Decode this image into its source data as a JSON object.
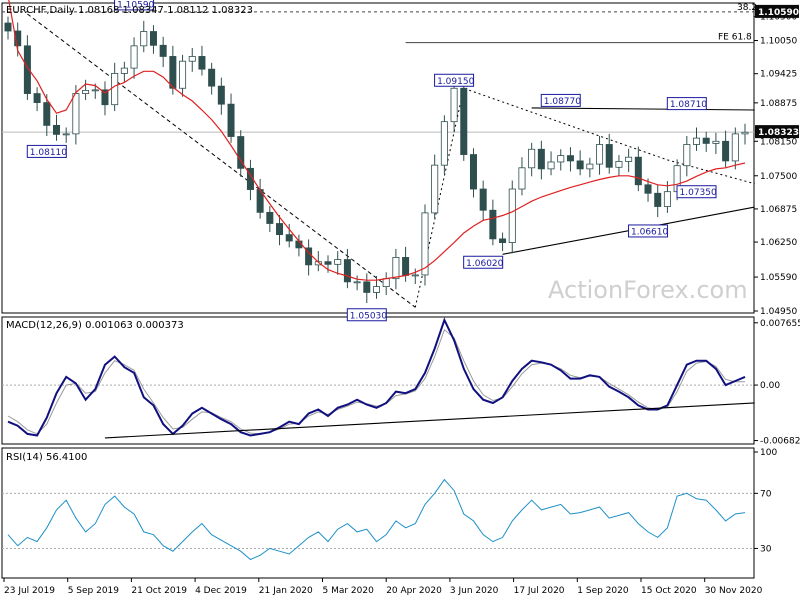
{
  "window": {
    "symbol": "EURCHF,Daily",
    "ohlc": "1.08168 1.08347 1.08112 1.08323",
    "watermark": "ActionForex.com"
  },
  "chart_data": [
    {
      "type": "candlestick",
      "panel": "price",
      "ylim": [
        1.0495,
        1.1072
      ],
      "y_ticks": [
        "1.10500",
        "1.10050",
        "1.09425",
        "1.08875",
        "1.08323",
        "1.08150",
        "1.07500",
        "1.06875",
        "1.06250",
        "1.05590",
        "1.04950"
      ],
      "current_price": "1.08323",
      "top_price_label": "1.10590",
      "top_level_label": "38.2",
      "fe_label": "FE 61.8",
      "fe_level": 1.1001,
      "resistance_line": [
        {
          "x": 54,
          "y": 1.0878
        },
        {
          "x": 77,
          "y": 1.0874
        }
      ],
      "support_line": [
        {
          "x": 51,
          "y": 1.0602
        },
        {
          "x": 77,
          "y": 1.0691
        }
      ],
      "down_trend_line": [
        {
          "x": 2,
          "y": 1.1055
        },
        {
          "x": 42,
          "y": 1.0502
        }
      ],
      "projection_line": [
        {
          "x": 42,
          "y": 1.0502
        },
        {
          "x": 47,
          "y": 1.0915
        },
        {
          "x": 68,
          "y": 1.078
        },
        {
          "x": 77,
          "y": 1.0735
        }
      ],
      "fe_line_x": [
        41,
        77
      ],
      "annotations": [
        {
          "text": "1.10590",
          "x": 13,
          "y": 1.1059
        },
        {
          "text": "1.08110",
          "x": 4,
          "y": 1.0811
        },
        {
          "text": "1.09150",
          "x": 46,
          "y": 1.0915
        },
        {
          "text": "1.08770",
          "x": 57,
          "y": 1.0877
        },
        {
          "text": "1.08710",
          "x": 70,
          "y": 1.0871
        },
        {
          "text": "1.07350",
          "x": 71,
          "y": 1.0735
        },
        {
          "text": "1.06610",
          "x": 66,
          "y": 1.0661
        },
        {
          "text": "1.06020",
          "x": 49,
          "y": 1.0602
        },
        {
          "text": "1.05030",
          "x": 37,
          "y": 1.0503
        }
      ],
      "closes": [
        1.1023,
        1.0995,
        1.0905,
        1.0888,
        1.0845,
        1.0828,
        1.0829,
        1.0905,
        1.0911,
        1.0912,
        1.0884,
        1.0943,
        1.0953,
        1.0995,
        1.1022,
        1.0996,
        1.0975,
        1.0915,
        1.0966,
        1.0975,
        1.0951,
        1.0919,
        1.0885,
        1.0824,
        1.0764,
        1.0724,
        1.0681,
        1.066,
        1.0639,
        1.0627,
        1.0614,
        1.0582,
        1.0588,
        1.0583,
        1.0592,
        1.055,
        1.055,
        1.053,
        1.0541,
        1.0556,
        1.0596,
        1.0562,
        1.0563,
        1.068,
        1.077,
        1.0852,
        1.0915,
        1.079,
        1.0725,
        1.0685,
        1.0631,
        1.0624,
        1.0725,
        1.0765,
        1.08,
        1.0763,
        1.0776,
        1.0788,
        1.0778,
        1.0763,
        1.0772,
        1.0809,
        1.0766,
        1.0777,
        1.0785,
        1.0733,
        1.0717,
        1.0692,
        1.072,
        1.0769,
        1.0809,
        1.0821,
        1.0811,
        1.0815,
        1.0778,
        1.0829,
        1.0832
      ],
      "moving_average": [
        1.109,
        1.0986,
        1.0954,
        1.0929,
        1.0894,
        1.0868,
        1.0874,
        1.0907,
        1.0923,
        1.092,
        1.0906,
        1.0919,
        1.0926,
        1.0938,
        1.0947,
        1.0947,
        1.0936,
        1.0917,
        1.0903,
        1.0891,
        1.0874,
        1.0856,
        1.0834,
        1.0807,
        1.0779,
        1.0751,
        1.0723,
        1.0697,
        1.0672,
        1.0649,
        1.0627,
        1.0605,
        1.0587,
        1.0573,
        1.0566,
        1.0561,
        1.0555,
        1.0553,
        1.0553,
        1.0556,
        1.0559,
        1.0562,
        1.0568,
        1.0576,
        1.059,
        1.0607,
        1.0624,
        1.0642,
        1.0655,
        1.0666,
        1.067,
        1.0675,
        1.0682,
        1.0692,
        1.0702,
        1.071,
        1.0716,
        1.0722,
        1.0728,
        1.0733,
        1.0738,
        1.0743,
        1.0747,
        1.075,
        1.075,
        1.0746,
        1.0739,
        1.0733,
        1.0731,
        1.0734,
        1.074,
        1.0749,
        1.0757,
        1.0763,
        1.0765,
        1.077,
        1.0774
      ]
    },
    {
      "type": "line",
      "panel": "macd",
      "label": "MACD(12,26,9) 0.001063 0.000373",
      "ylim": [
        -0.007,
        0.008
      ],
      "y_ticks": [
        "0.007655",
        "0.00",
        "-0.006822"
      ],
      "trend_line": [
        {
          "x": 10,
          "y": -0.0065
        },
        {
          "x": 77,
          "y": -0.0022
        }
      ],
      "macd": [
        -0.0045,
        -0.005,
        -0.006,
        -0.0062,
        -0.004,
        -0.001,
        0.001,
        0.0002,
        -0.0018,
        -0.0005,
        0.0025,
        0.0035,
        0.0022,
        0.0015,
        -0.0015,
        -0.0025,
        -0.0048,
        -0.006,
        -0.005,
        -0.0035,
        -0.0028,
        -0.0035,
        -0.0042,
        -0.0048,
        -0.0058,
        -0.0062,
        -0.006,
        -0.0058,
        -0.0052,
        -0.0045,
        -0.0048,
        -0.0035,
        -0.003,
        -0.0038,
        -0.0028,
        -0.0024,
        -0.0018,
        -0.0024,
        -0.0028,
        -0.0022,
        -0.0008,
        -0.001,
        -0.0005,
        0.0015,
        0.0045,
        0.008,
        0.0055,
        0.002,
        -0.0005,
        -0.0018,
        -0.0022,
        -0.0015,
        0.0005,
        0.002,
        0.003,
        0.0028,
        0.0025,
        0.0018,
        0.0008,
        0.0008,
        0.0012,
        0.001,
        -0.0002,
        -0.0008,
        -0.0015,
        -0.0025,
        -0.003,
        -0.003,
        -0.0025,
        0.0,
        0.0025,
        0.003,
        0.003,
        0.002,
        0.0,
        0.0005,
        0.001
      ],
      "signal": [
        -0.0038,
        -0.0045,
        -0.0055,
        -0.006,
        -0.0048,
        -0.0022,
        0.0,
        0.0002,
        -0.001,
        -0.0008,
        0.0015,
        0.003,
        0.0025,
        0.0018,
        -0.0005,
        -0.0022,
        -0.004,
        -0.0054,
        -0.0052,
        -0.0042,
        -0.0033,
        -0.0034,
        -0.004,
        -0.0045,
        -0.0054,
        -0.0059,
        -0.006,
        -0.0058,
        -0.0054,
        -0.0048,
        -0.0047,
        -0.0038,
        -0.0033,
        -0.0036,
        -0.003,
        -0.0026,
        -0.0021,
        -0.0023,
        -0.0026,
        -0.0023,
        -0.0013,
        -0.0011,
        -0.0007,
        0.0008,
        0.0035,
        0.0068,
        0.0058,
        0.003,
        0.0005,
        -0.0012,
        -0.0019,
        -0.0016,
        -0.0002,
        0.0014,
        0.0025,
        0.0027,
        0.0025,
        0.002,
        0.0012,
        0.0009,
        0.0011,
        0.001,
        0.0002,
        -0.0005,
        -0.0012,
        -0.0021,
        -0.0028,
        -0.003,
        -0.0027,
        -0.0008,
        0.0017,
        0.0027,
        0.0029,
        0.0023,
        0.0007,
        0.0004,
        0.0004
      ]
    },
    {
      "type": "line",
      "panel": "rsi",
      "label": "RSI(14) 56.4100",
      "ylim": [
        10,
        100
      ],
      "y_ticks": [
        "100",
        "70",
        "30"
      ],
      "rsi": [
        40,
        32,
        38,
        35,
        45,
        58,
        65,
        52,
        42,
        48,
        62,
        68,
        60,
        55,
        42,
        40,
        32,
        28,
        35,
        42,
        48,
        40,
        36,
        32,
        28,
        22,
        25,
        30,
        28,
        26,
        32,
        38,
        42,
        35,
        44,
        48,
        42,
        44,
        35,
        40,
        50,
        45,
        48,
        62,
        70,
        80,
        72,
        55,
        50,
        40,
        35,
        38,
        50,
        58,
        65,
        58,
        60,
        62,
        55,
        56,
        58,
        60,
        52,
        54,
        56,
        48,
        42,
        38,
        45,
        68,
        70,
        66,
        65,
        58,
        50,
        55,
        56
      ]
    }
  ],
  "x_axis": {
    "labels": [
      "23 Jul 2019",
      "5 Sep 2019",
      "21 Oct 2019",
      "4 Dec 2019",
      "21 Jan 2020",
      "5 Mar 2020",
      "20 Apr 2020",
      "3 Jun 2020",
      "17 Jul 2020",
      "1 Sep 2020",
      "15 Oct 2020",
      "30 Nov 2020"
    ]
  }
}
